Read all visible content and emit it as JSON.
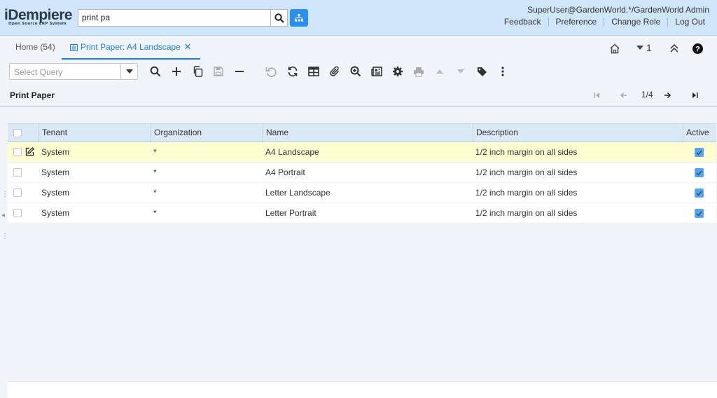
{
  "header": {
    "logo_word": "iDempiere",
    "logo_tagline": "Open Source ERP System",
    "search_value": "print pa",
    "user": "SuperUser@GardenWorld.*/GardenWorld Admin",
    "links": [
      "Feedback",
      "Preference",
      "Change Role",
      "Log Out"
    ],
    "tree_button_color": "#2b8ff0"
  },
  "tabs": {
    "home_label": "Home (54)",
    "active_label": "Print Paper: A4 Landscape",
    "open_count": "1"
  },
  "toolbar": {
    "query_placeholder": "Select Query"
  },
  "window": {
    "title": "Print Paper",
    "record_nav": "1/4"
  },
  "grid": {
    "columns": [
      "Tenant",
      "Organization",
      "Name",
      "Description",
      "Active"
    ],
    "rows": [
      {
        "tenant": "System",
        "organization": "*",
        "name": "A4 Landscape",
        "description": "1/2 inch margin on all sides",
        "active": true
      },
      {
        "tenant": "System",
        "organization": "*",
        "name": "A4 Portrait",
        "description": "1/2 inch margin on all sides",
        "active": true
      },
      {
        "tenant": "System",
        "organization": "*",
        "name": "Letter Landscape",
        "description": "1/2 inch margin on all sides",
        "active": true
      },
      {
        "tenant": "System",
        "organization": "*",
        "name": "Letter Portrait",
        "description": "1/2 inch margin on all sides",
        "active": true
      }
    ]
  },
  "colors": {
    "header_bg": "#cfe6fa",
    "accent": "#1e7fd9",
    "selected_row": "#fefed3",
    "grid_header": "#dbe9f7"
  }
}
